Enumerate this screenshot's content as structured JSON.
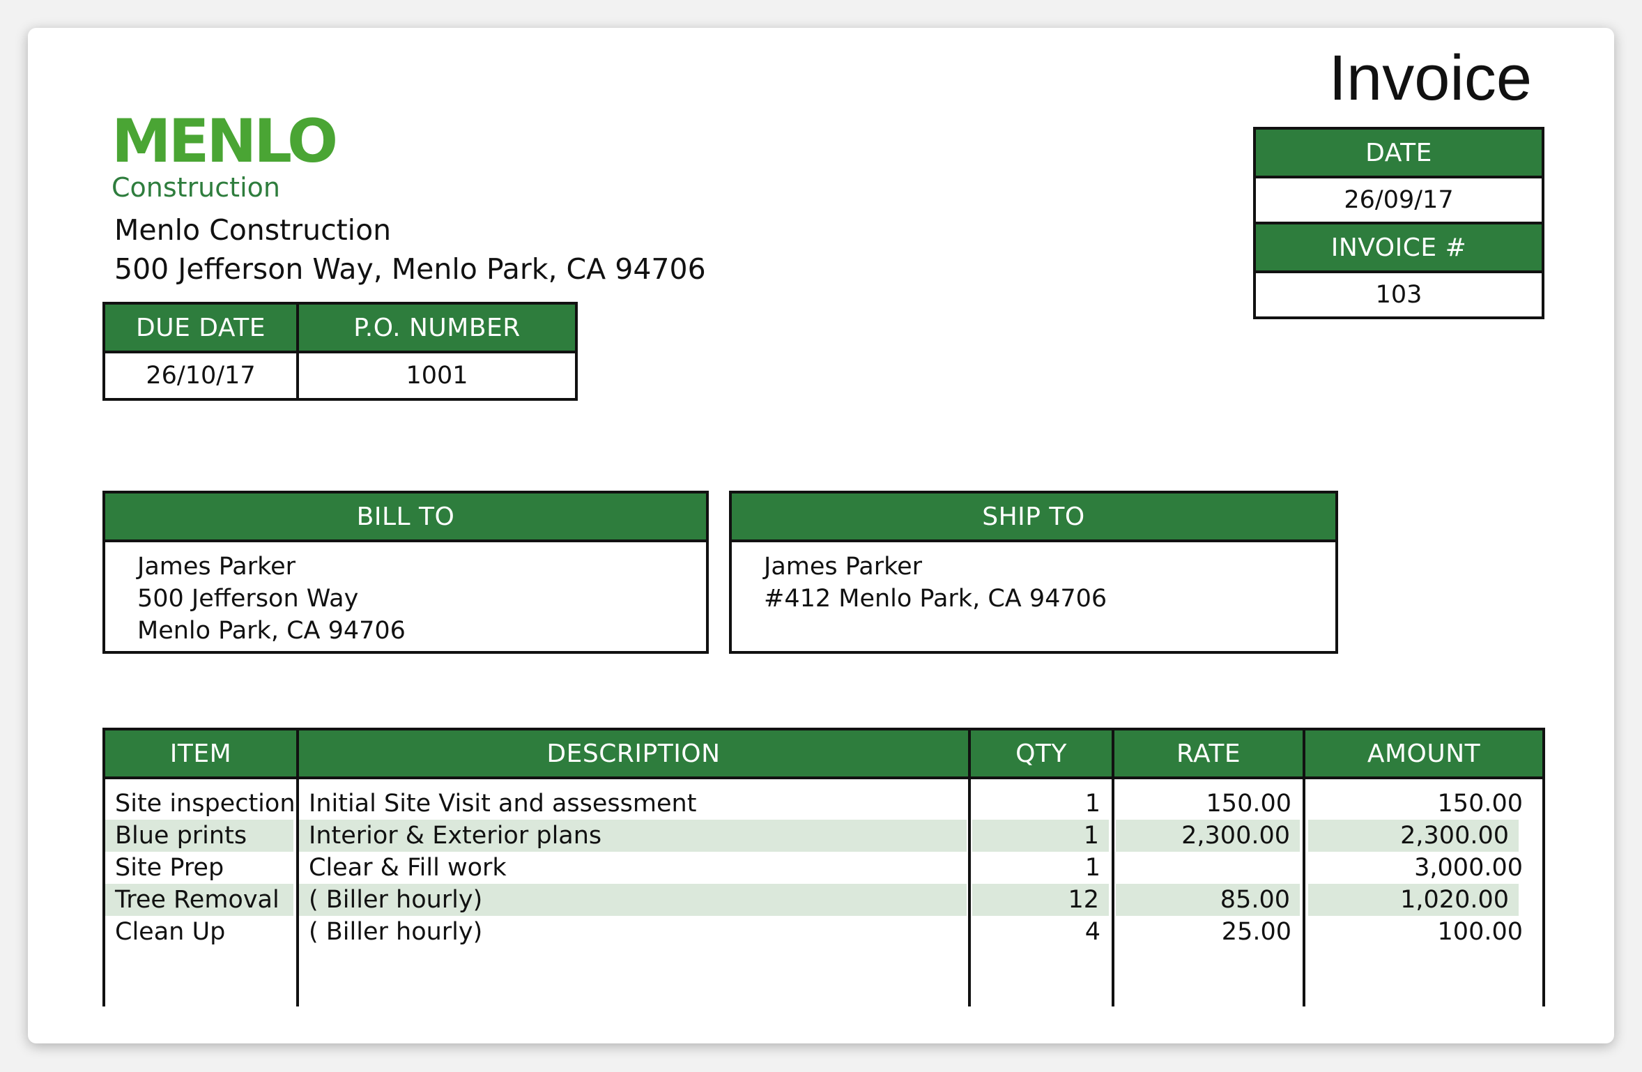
{
  "title": "Invoice",
  "logo": {
    "wordmark": "MENLO",
    "subtitle": "Construction",
    "color": "#4aa534"
  },
  "company": {
    "name": "Menlo Construction",
    "address": "500 Jefferson Way, Menlo Park, CA 94706"
  },
  "date_box": {
    "date_label": "DATE",
    "date_value": "26/09/17",
    "invoice_label": "INVOICE #",
    "invoice_value": "103"
  },
  "due_box": {
    "due_label": "DUE DATE",
    "due_value": "26/10/17",
    "po_label": "P.O. NUMBER",
    "po_value": "1001"
  },
  "bill_to": {
    "label": "BILL TO",
    "lines": [
      "James Parker",
      "500 Jefferson Way",
      "Menlo Park, CA 94706"
    ]
  },
  "ship_to": {
    "label": "SHIP TO",
    "lines": [
      "James Parker",
      "#412 Menlo Park, CA 94706"
    ]
  },
  "items": {
    "headers": [
      "ITEM",
      "DESCRIPTION",
      "QTY",
      "RATE",
      "AMOUNT"
    ],
    "rows": [
      {
        "item": "Site inspection",
        "description": "Initial Site Visit and assessment",
        "qty": "1",
        "rate": "150.00",
        "amount": "150.00"
      },
      {
        "item": "Blue prints",
        "description": "Interior & Exterior plans",
        "qty": "1",
        "rate": "2,300.00",
        "amount": "2,300.00"
      },
      {
        "item": "Site Prep",
        "description": "Clear & Fill work",
        "qty": "1",
        "rate": "",
        "amount": "3,000.00"
      },
      {
        "item": "Tree Removal",
        "description": "( Biller hourly)",
        "qty": "12",
        "rate": "85.00",
        "amount": "1,020.00"
      },
      {
        "item": "Clean Up",
        "description": "( Biller hourly)",
        "qty": "4",
        "rate": "25.00",
        "amount": "100.00"
      }
    ]
  },
  "colors": {
    "header_green": "#2e7d3d",
    "stripe": "#dbe8db"
  }
}
